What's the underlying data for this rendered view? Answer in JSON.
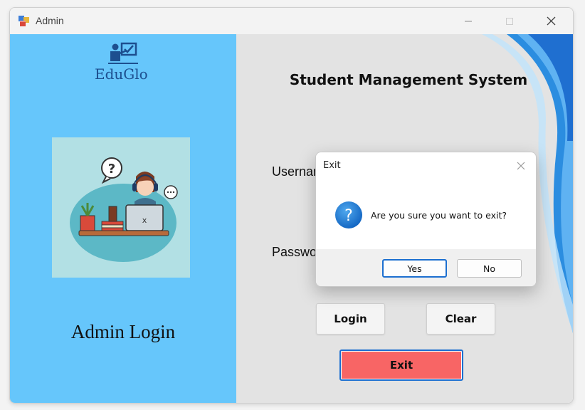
{
  "window": {
    "title": "Admin"
  },
  "left_panel": {
    "logo_text": "EduGlo",
    "caption": "Admin Login"
  },
  "main": {
    "heading": "Student Management System",
    "username_label": "Usernar",
    "password_label": "Passwo",
    "login_label": "Login",
    "clear_label": "Clear",
    "exit_label": "Exit"
  },
  "dialog": {
    "title": "Exit",
    "message": "Are you sure you want to exit?",
    "yes_label": "Yes",
    "no_label": "No"
  },
  "colors": {
    "left_panel_bg": "#66c6fb",
    "right_panel_bg": "#e3e3e3",
    "exit_button_bg": "#f86565",
    "focus_border": "#1c6fd0",
    "logo_color": "#1d4f8f"
  }
}
